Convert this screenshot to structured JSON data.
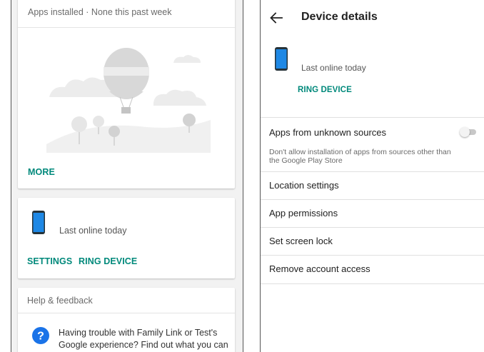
{
  "colors": {
    "accent": "#00897b",
    "phone": "#1e88e5",
    "help_icon": "#1a73e8"
  },
  "left_panel": {
    "apps_card": {
      "header": "Apps installed · None this past week",
      "more_label": "MORE"
    },
    "device_card": {
      "status": "Last online today",
      "settings_label": "SETTINGS",
      "ring_label": "RING DEVICE"
    },
    "help_card": {
      "header": "Help & feedback",
      "text": "Having trouble with Family Link or Test's Google experience? Find out what you can do."
    }
  },
  "right_panel": {
    "title": "Device details",
    "device": {
      "status": "Last online today",
      "ring_label": "RING DEVICE"
    },
    "unknown_sources": {
      "label": "Apps from unknown sources",
      "description": "Don't allow installation of apps from sources other than the Google Play Store",
      "enabled": false
    },
    "menu": [
      {
        "label": "Location settings"
      },
      {
        "label": "App permissions"
      },
      {
        "label": "Set screen lock"
      },
      {
        "label": "Remove account access"
      }
    ]
  }
}
